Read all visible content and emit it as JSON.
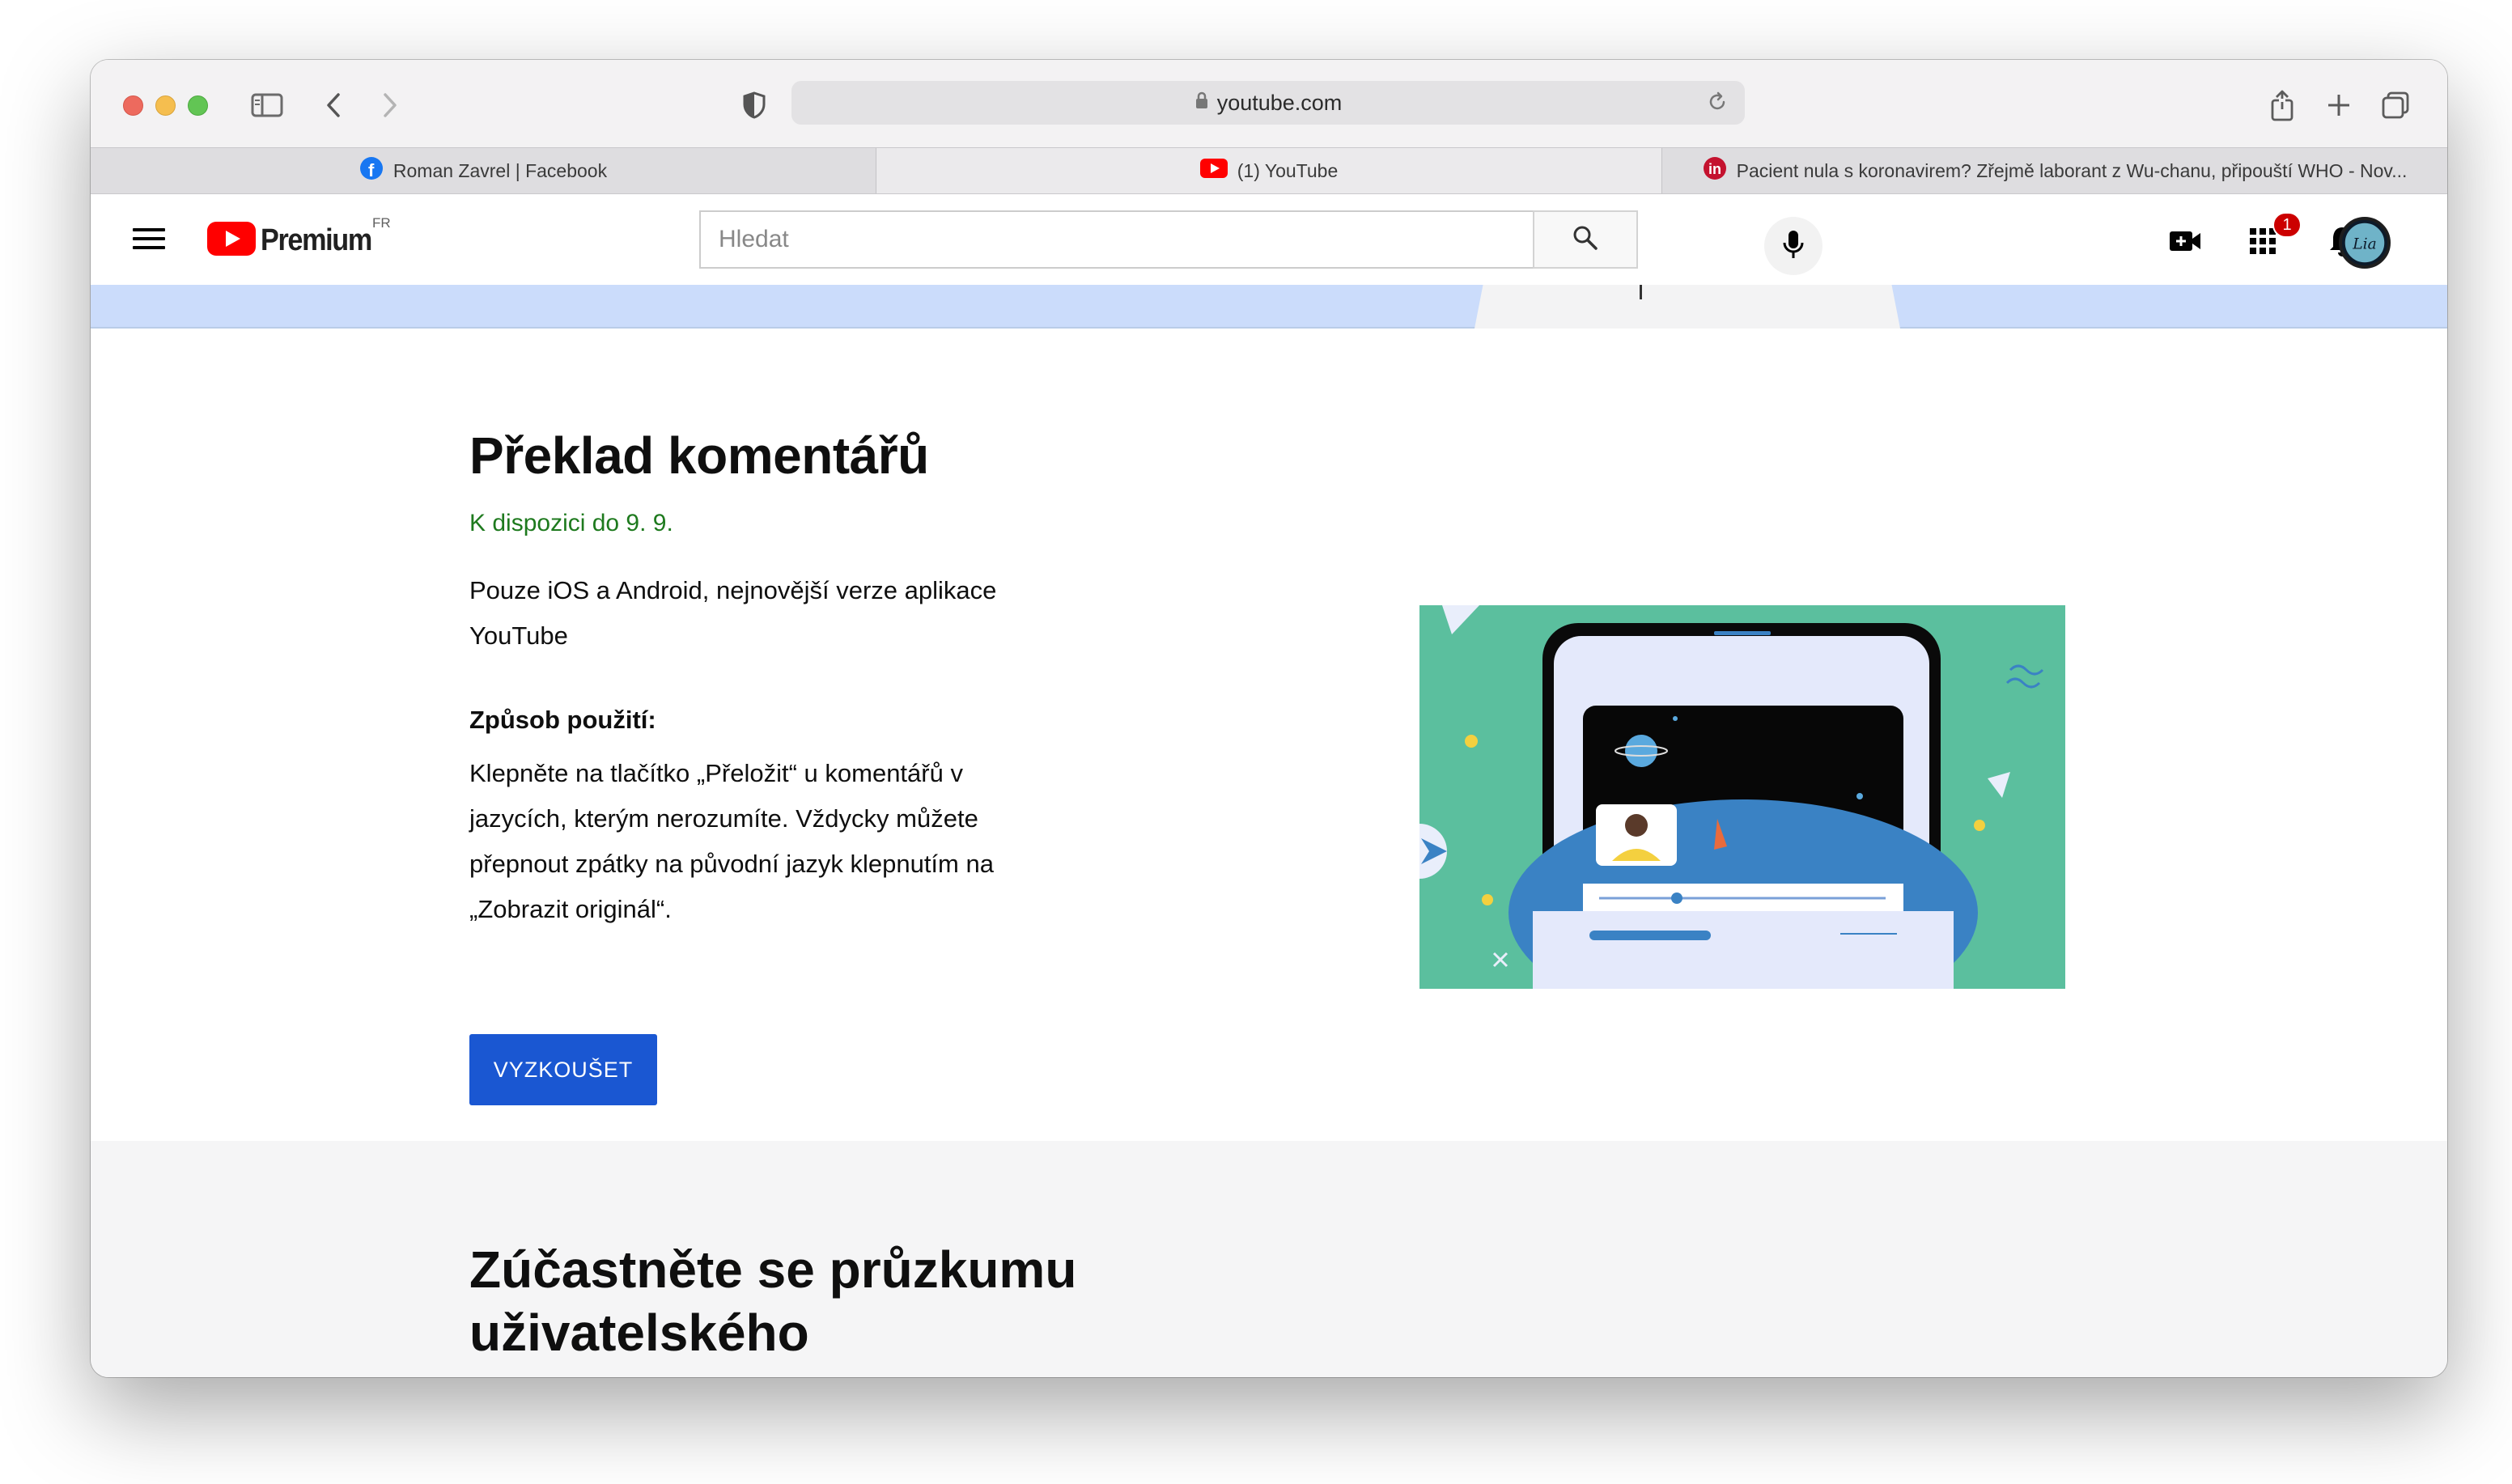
{
  "browser": {
    "address": "youtube.com",
    "tabs": [
      {
        "label": "Roman Zavrel | Facebook",
        "icon": "facebook-icon",
        "active": false
      },
      {
        "label": "(1) YouTube",
        "icon": "youtube-icon",
        "active": true
      },
      {
        "label": "Pacient nula s koronavirem? Zřejmě laborant z Wu-chanu, připouští WHO - Nov...",
        "icon": "news-icon",
        "active": false
      }
    ]
  },
  "header": {
    "logo_text": "Premium",
    "country_code": "FR",
    "search_placeholder": "Hledat",
    "notification_count": "1",
    "avatar_initials": "Lia"
  },
  "feature": {
    "title": "Překlad komentářů",
    "availability": "K dispozici do 9. 9.",
    "platform": "Pouze iOS a Android, nejnovější verze aplikace YouTube",
    "howto_label": "Způsob použití:",
    "howto_text": "Klepněte na tlačítko „Přeložit“ u komentářů v jazycích, kterým nerozumíte. Vždycky můžete přepnout zpátky na původní jazyk klepnutím na „Zobrazit originál“.",
    "button_label": "VYZKOUŠET"
  },
  "survey": {
    "title": "Zúčastněte se průzkumu uživatelského"
  },
  "colors": {
    "accent_blue": "#1a57d2",
    "availability_green": "#1e7a1e",
    "youtube_red": "#ff0000",
    "illustration_teal": "#5bbf9e",
    "hero_strip": "#cbdcfb"
  }
}
